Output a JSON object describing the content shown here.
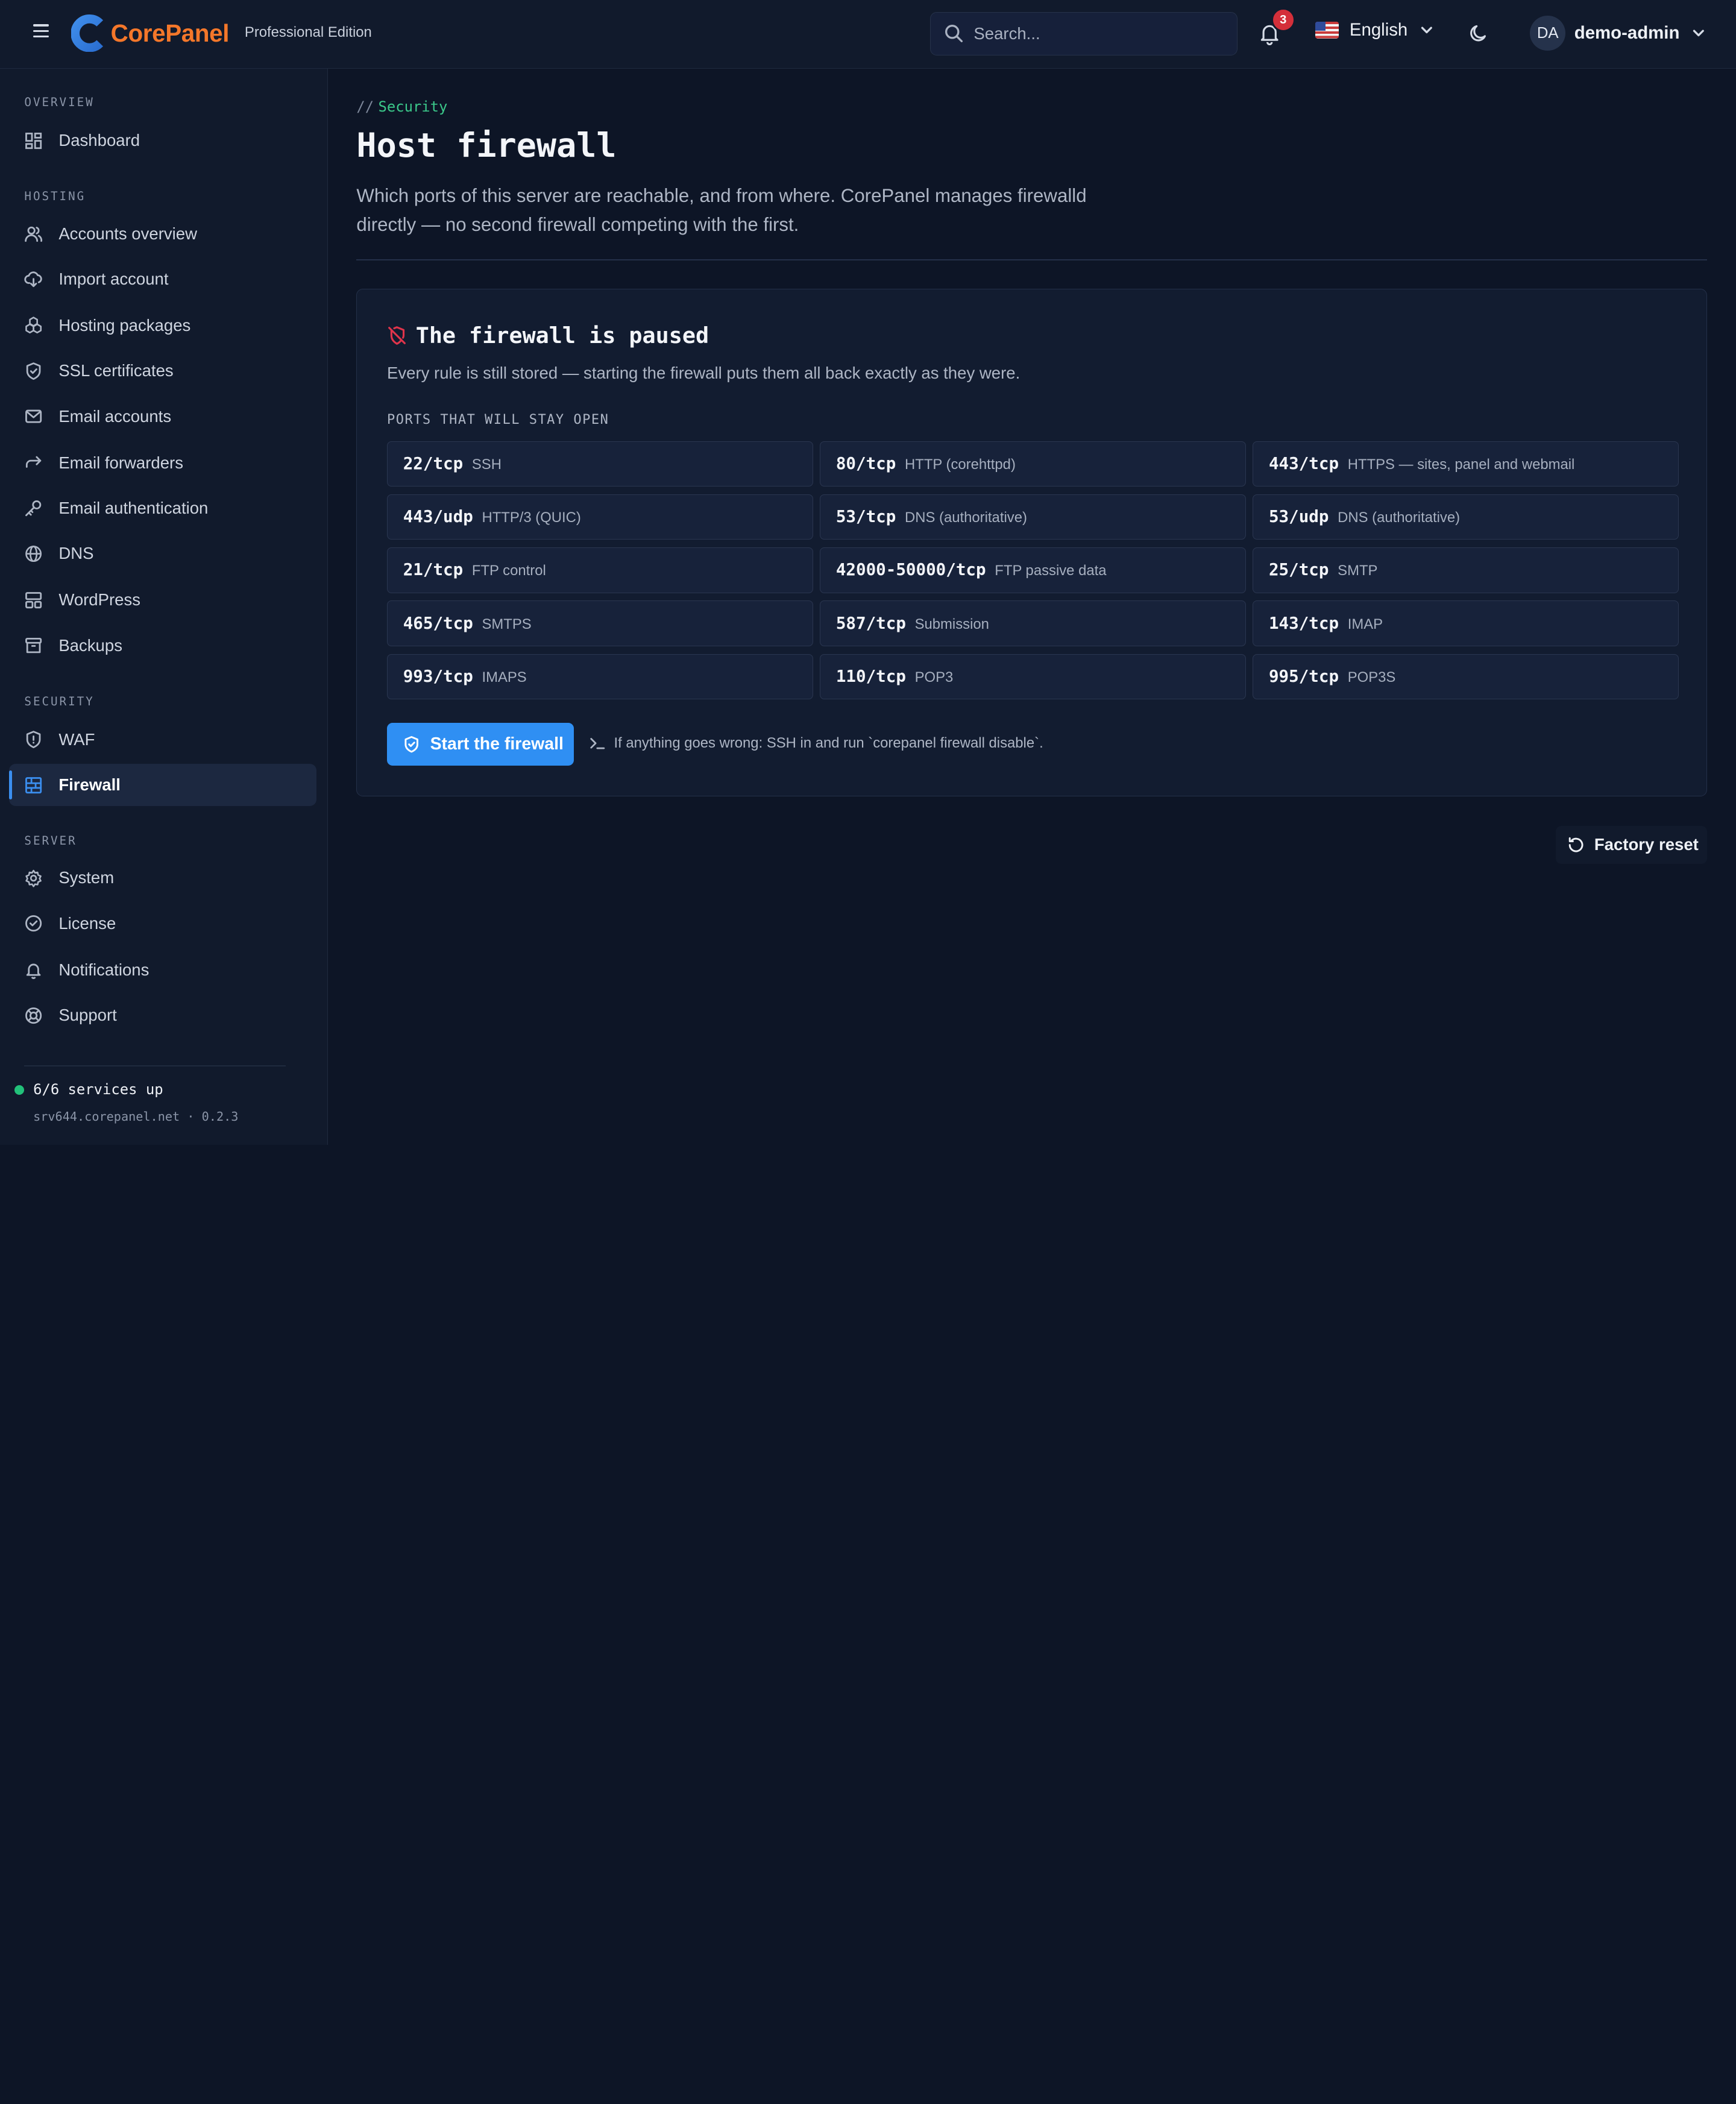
{
  "brand": {
    "logo_letter": "C",
    "name": "CorePanel",
    "edition": "Professional Edition",
    "color": "#f4772a"
  },
  "header": {
    "search_placeholder": "Search...",
    "notification_count": "3",
    "language": "English",
    "user_initials": "DA",
    "user_name": "demo-admin"
  },
  "sidebar": {
    "sections": [
      {
        "label": "OVERVIEW",
        "items": [
          {
            "label": "Dashboard",
            "icon": "dashboard-icon"
          }
        ]
      },
      {
        "label": "HOSTING",
        "items": [
          {
            "label": "Accounts overview",
            "icon": "users-icon"
          },
          {
            "label": "Import account",
            "icon": "cloud-download-icon"
          },
          {
            "label": "Hosting packages",
            "icon": "packages-icon"
          },
          {
            "label": "SSL certificates",
            "icon": "shield-check-icon"
          },
          {
            "label": "Email accounts",
            "icon": "mail-icon"
          },
          {
            "label": "Email forwarders",
            "icon": "forward-icon"
          },
          {
            "label": "Email authentication",
            "icon": "key-icon"
          },
          {
            "label": "DNS",
            "icon": "globe-icon"
          },
          {
            "label": "WordPress",
            "icon": "layout-icon"
          },
          {
            "label": "Backups",
            "icon": "archive-icon"
          }
        ]
      },
      {
        "label": "SECURITY",
        "items": [
          {
            "label": "WAF",
            "icon": "shield-alert-icon"
          },
          {
            "label": "Firewall",
            "icon": "brick-wall-icon",
            "active": true
          }
        ]
      },
      {
        "label": "SERVER",
        "items": [
          {
            "label": "System",
            "icon": "gear-icon"
          },
          {
            "label": "License",
            "icon": "badge-check-icon"
          },
          {
            "label": "Notifications",
            "icon": "bell-icon"
          },
          {
            "label": "Support",
            "icon": "life-buoy-icon"
          }
        ]
      }
    ],
    "status": "6/6 services up",
    "host": "srv644.corepanel.net · 0.2.3"
  },
  "page": {
    "breadcrumb_prefix": "//",
    "breadcrumb_section": "Security",
    "title": "Host firewall",
    "description": "Which ports of this server are reachable, and from where. CorePanel manages firewalld directly — no second firewall competing with the first."
  },
  "card": {
    "title": "The firewall is paused",
    "subtitle": "Every rule is still stored — starting the firewall puts them all back exactly as they were.",
    "ports_label": "PORTS THAT WILL STAY OPEN",
    "ports": [
      {
        "port": "22/tcp",
        "name": "SSH"
      },
      {
        "port": "80/tcp",
        "name": "HTTP (corehttpd)"
      },
      {
        "port": "443/tcp",
        "name": "HTTPS — sites, panel and webmail"
      },
      {
        "port": "443/udp",
        "name": "HTTP/3 (QUIC)"
      },
      {
        "port": "53/tcp",
        "name": "DNS (authoritative)"
      },
      {
        "port": "53/udp",
        "name": "DNS (authoritative)"
      },
      {
        "port": "21/tcp",
        "name": "FTP control"
      },
      {
        "port": "42000-50000/tcp",
        "name": "FTP passive data"
      },
      {
        "port": "25/tcp",
        "name": "SMTP"
      },
      {
        "port": "465/tcp",
        "name": "SMTPS"
      },
      {
        "port": "587/tcp",
        "name": "Submission"
      },
      {
        "port": "143/tcp",
        "name": "IMAP"
      },
      {
        "port": "993/tcp",
        "name": "IMAPS"
      },
      {
        "port": "110/tcp",
        "name": "POP3"
      },
      {
        "port": "995/tcp",
        "name": "POP3S"
      }
    ],
    "start_button": "Start the firewall",
    "hint": "If anything goes wrong: SSH in and run `corepanel firewall disable`."
  },
  "factory_reset": "Factory reset",
  "colors": {
    "accent": "#2f8ff3",
    "success": "#22c17a",
    "danger": "#e0344b",
    "section_green": "#3bc88a"
  }
}
